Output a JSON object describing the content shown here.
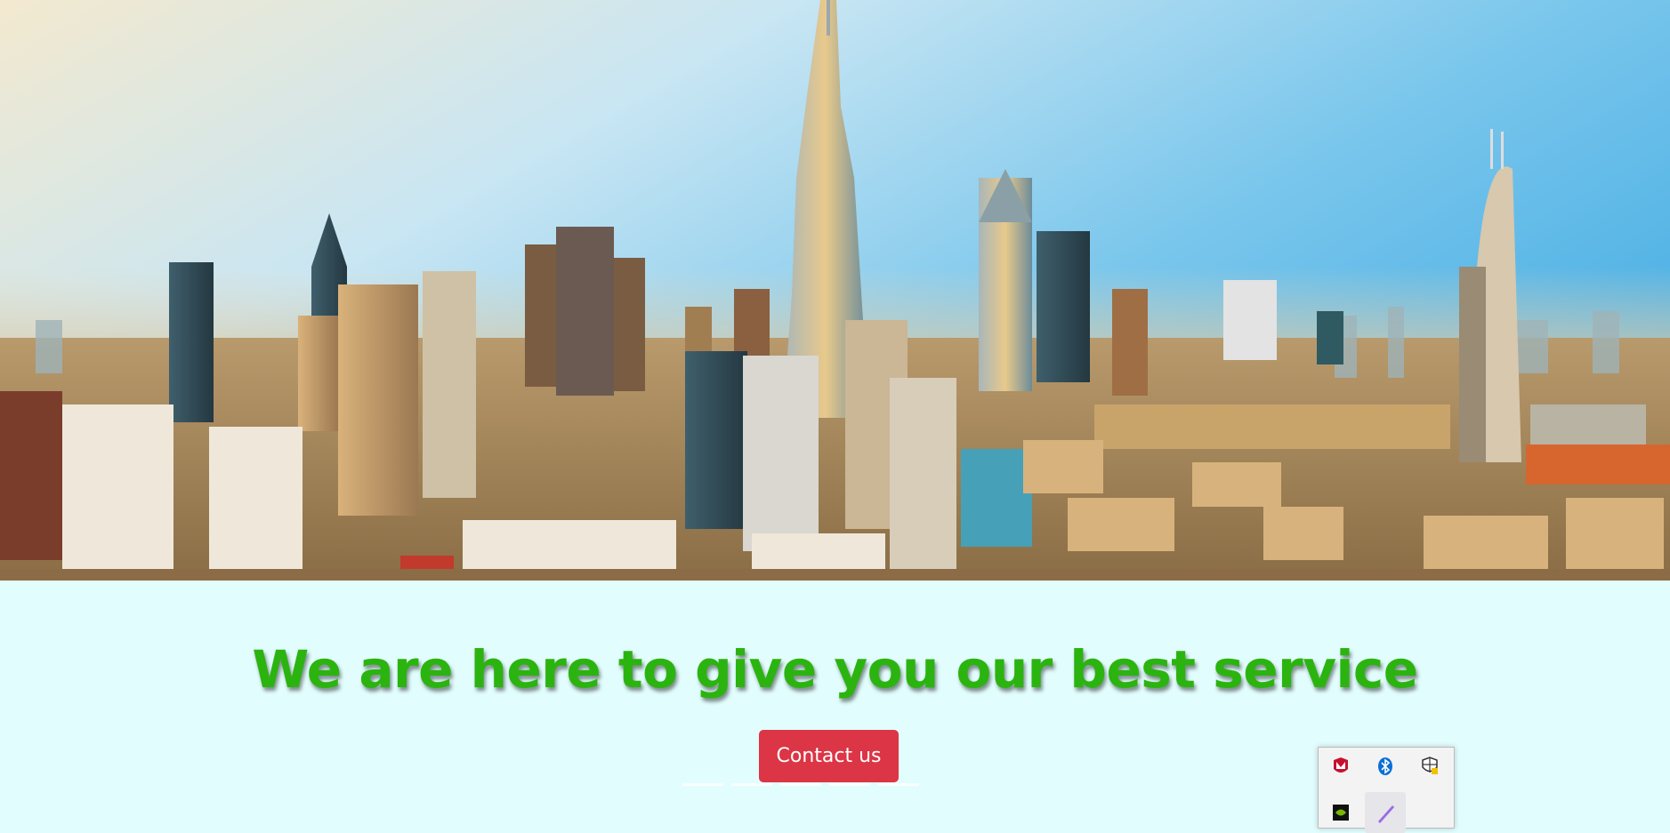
{
  "hero": {
    "image_alt": "Dubai skyline"
  },
  "main": {
    "headline": "We are here to give you our best service",
    "contact_button": "Contact us",
    "carousel_indicator_count": 5
  },
  "tray": {
    "icons": [
      "mcafee-icon",
      "bluetooth-icon",
      "windows-security-icon",
      "nvidia-icon",
      "pen-icon"
    ]
  },
  "colors": {
    "background": "#e2fdfd",
    "headline": "#2bb40f",
    "button": "#dc3545"
  }
}
